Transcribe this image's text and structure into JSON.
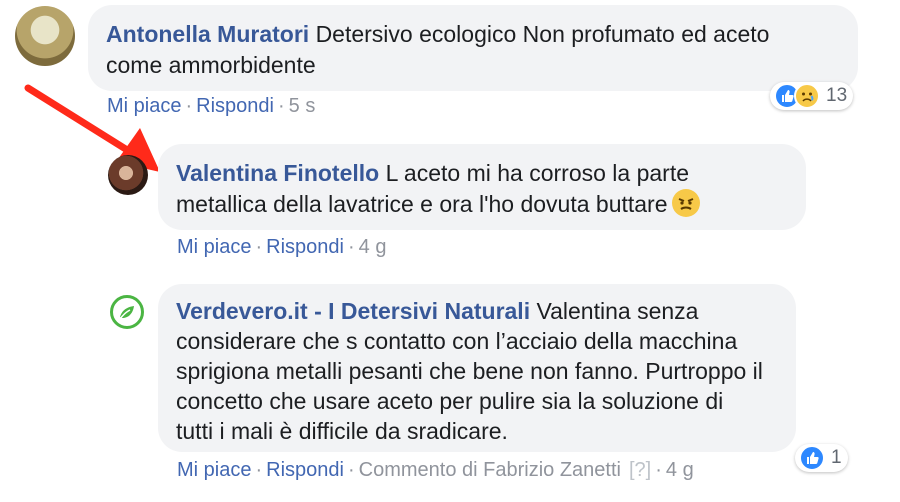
{
  "comments": [
    {
      "author": "Antonella Muratori",
      "text_line1": "Detersivo ecologico Non profumato ed aceto",
      "text_line2": "come ammorbidente",
      "like": "Mi piace",
      "reply": "Rispondi",
      "time": "5 s",
      "reaction_count": "13"
    },
    {
      "author": "Valentina Finotello",
      "text_line1": "L aceto mi ha corroso la parte",
      "text_line2": "metallica della lavatrice e ora l'ho dovuta buttare",
      "like": "Mi piace",
      "reply": "Rispondi",
      "time": "4 g"
    },
    {
      "author": "Verdevero.it - I Detersivi Naturali",
      "text_line1": "Valentina senza",
      "text_line2": "considerare che s contatto con l’acciaio della macchina",
      "text_line3": "sprigiona metalli pesanti che bene non fanno. Purtroppo il",
      "text_line4": "concetto che usare aceto per pulire sia la soluzione di",
      "text_line5": "tutti i mali è difficile da sradicare.",
      "like": "Mi piace",
      "reply": "Rispondi",
      "comment_by": "Commento di Fabrizio Zanetti",
      "help": "[?]",
      "time": "4 g",
      "reaction_count": "1"
    }
  ],
  "colors": {
    "link": "#4267b2",
    "author": "#385898",
    "bubble": "#f2f3f5",
    "arrow": "#ff2a1a",
    "verified": "#4bb543"
  },
  "icons": [
    "like-reaction-icon",
    "sad-reaction-icon",
    "angry-emoji-icon",
    "verified-leaf-icon",
    "red-arrow-annotation"
  ]
}
